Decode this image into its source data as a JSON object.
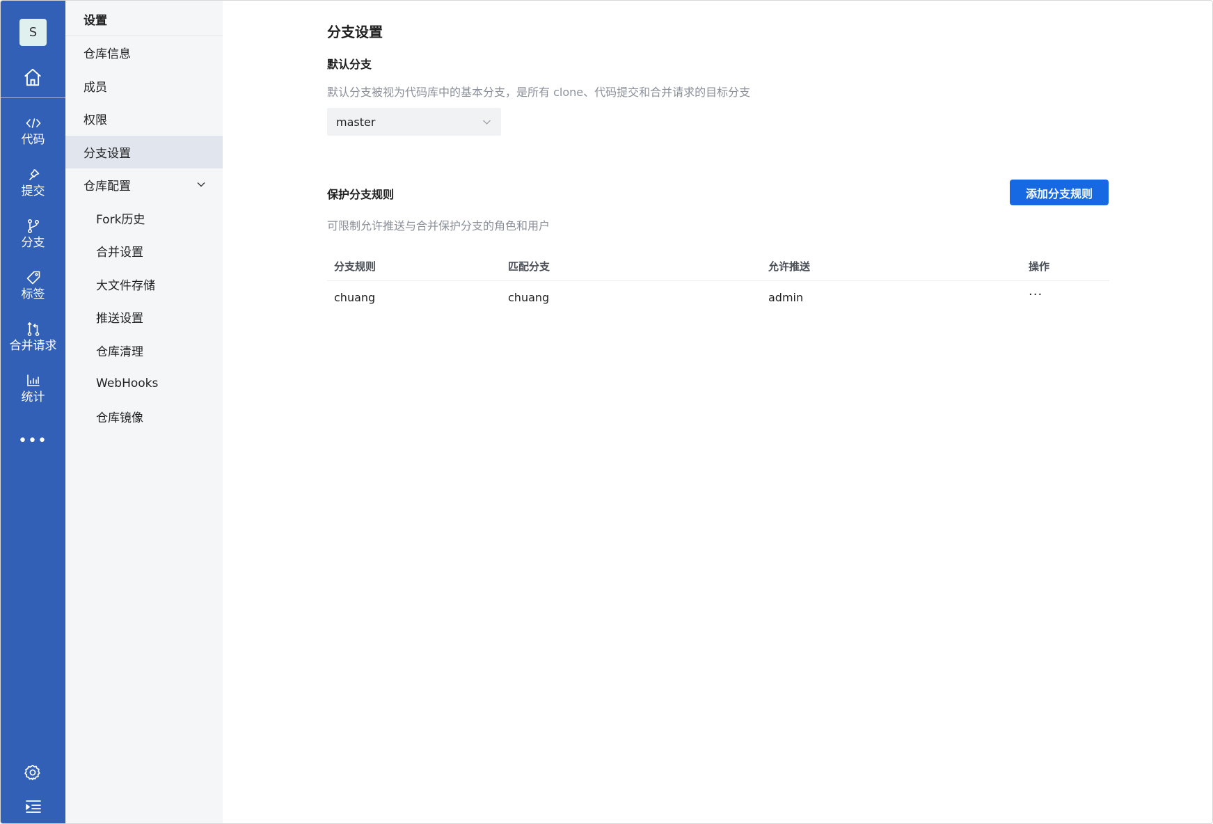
{
  "rail": {
    "avatar": "S",
    "items": [
      {
        "label": "代码",
        "icon": "code-icon"
      },
      {
        "label": "提交",
        "icon": "pin-icon"
      },
      {
        "label": "分支",
        "icon": "branch-icon"
      },
      {
        "label": "标签",
        "icon": "tag-icon"
      },
      {
        "label": "合并请求",
        "icon": "merge-request-icon"
      },
      {
        "label": "统计",
        "icon": "bar-chart-icon"
      }
    ],
    "more": "•••"
  },
  "sidebar": {
    "title": "设置",
    "items": [
      {
        "label": "仓库信息"
      },
      {
        "label": "成员"
      },
      {
        "label": "权限"
      },
      {
        "label": "分支设置"
      },
      {
        "label": "仓库配置"
      },
      {
        "label": "Fork历史"
      },
      {
        "label": "合并设置"
      },
      {
        "label": "大文件存储"
      },
      {
        "label": "推送设置"
      },
      {
        "label": "仓库清理"
      },
      {
        "label": "WebHooks"
      },
      {
        "label": "仓库镜像"
      }
    ]
  },
  "main": {
    "title": "分支设置",
    "default_branch": {
      "heading": "默认分支",
      "description": "默认分支被视为代码库中的基本分支，是所有 clone、代码提交和合并请求的目标分支",
      "selected": "master"
    },
    "protected": {
      "heading": "保护分支规则",
      "description": "可限制允许推送与合并保护分支的角色和用户",
      "add_button": "添加分支规则",
      "columns": [
        "分支规则",
        "匹配分支",
        "允许推送",
        "操作"
      ],
      "rows": [
        {
          "rule": "chuang",
          "match": "chuang",
          "push": "admin",
          "action": "···"
        }
      ]
    }
  },
  "colors": {
    "rail_bg": "#3160b6",
    "sidebar_bg": "#f5f6f8",
    "sidebar_active": "#e1e5ee",
    "primary_button": "#1668e3"
  }
}
